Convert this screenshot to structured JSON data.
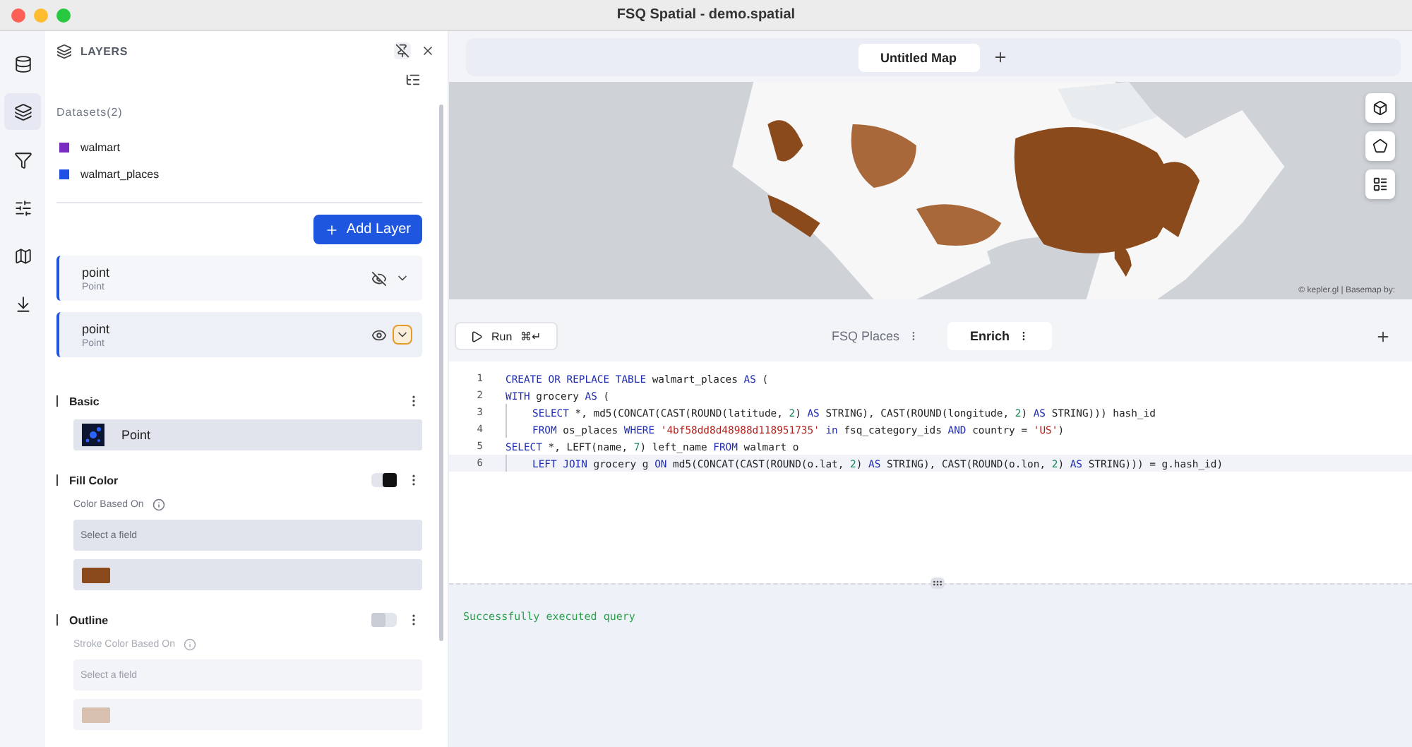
{
  "window": {
    "title": "FSQ Spatial - demo.spatial"
  },
  "rail": [
    {
      "selected": false
    },
    {
      "selected": true
    },
    {
      "selected": false
    },
    {
      "selected": false
    },
    {
      "selected": false
    },
    {
      "selected": false
    }
  ],
  "layers_panel": {
    "title": "LAYERS",
    "datasets_label": "Datasets(2)",
    "datasets": [
      {
        "name": "walmart",
        "color": "#7a2bc0"
      },
      {
        "name": "walmart_places",
        "color": "#1f50e6"
      }
    ],
    "add_button": "Add Layer",
    "layers": [
      {
        "name": "point",
        "type": "Point",
        "visible": false,
        "expanded": false
      },
      {
        "name": "point",
        "type": "Point",
        "visible": true,
        "expanded": true
      }
    ],
    "sections": [
      {
        "kind": "basic",
        "title": "Basic",
        "value": "Point"
      },
      {
        "kind": "color",
        "title": "Fill Color",
        "on": true,
        "label": "Color Based On",
        "placeholder": "Select a field",
        "color": "#8b4a1c"
      },
      {
        "kind": "color",
        "title": "Outline",
        "on": false,
        "label": "Stroke Color Based On",
        "placeholder": "Select a field",
        "color": "#d9c1b1"
      }
    ]
  },
  "map": {
    "tabs": [
      {
        "label": "Untitled Map",
        "selected": true
      }
    ],
    "attribution": "© kepler.gl | Basemap by:"
  },
  "editor": {
    "run_label": "Run",
    "run_shortcut": "⌘↵",
    "tabs": [
      {
        "label": "FSQ Places",
        "selected": false
      },
      {
        "label": "Enrich",
        "selected": true
      }
    ],
    "lines": [
      {
        "number": "1",
        "indent": false,
        "active": false,
        "tokens": [
          {
            "kind": "kw",
            "text": "CREATE OR REPLACE TABLE"
          },
          {
            "kind": "plain",
            "text": " walmart_places "
          },
          {
            "kind": "kw",
            "text": "AS"
          },
          {
            "kind": "plain",
            "text": " ("
          }
        ]
      },
      {
        "number": "2",
        "indent": false,
        "active": false,
        "tokens": [
          {
            "kind": "kw",
            "text": "WITH"
          },
          {
            "kind": "plain",
            "text": " grocery "
          },
          {
            "kind": "kw",
            "text": "AS"
          },
          {
            "kind": "plain",
            "text": " ("
          }
        ]
      },
      {
        "number": "3",
        "indent": true,
        "active": false,
        "tokens": [
          {
            "kind": "kw",
            "text": "SELECT"
          },
          {
            "kind": "plain",
            "text": " *, md5(CONCAT(CAST(ROUND(latitude, "
          },
          {
            "kind": "num",
            "text": "2"
          },
          {
            "kind": "plain",
            "text": ") "
          },
          {
            "kind": "kw",
            "text": "AS"
          },
          {
            "kind": "plain",
            "text": " STRING), CAST(ROUND(longitude, "
          },
          {
            "kind": "num",
            "text": "2"
          },
          {
            "kind": "plain",
            "text": ") "
          },
          {
            "kind": "kw",
            "text": "AS"
          },
          {
            "kind": "plain",
            "text": " STRING))) hash_id"
          }
        ]
      },
      {
        "number": "4",
        "indent": true,
        "active": false,
        "tokens": [
          {
            "kind": "kw",
            "text": "FROM"
          },
          {
            "kind": "plain",
            "text": " os_places "
          },
          {
            "kind": "kw",
            "text": "WHERE"
          },
          {
            "kind": "str",
            "text": " '4bf58dd8d48988d118951735'"
          },
          {
            "kind": "kw",
            "text": " in"
          },
          {
            "kind": "plain",
            "text": " fsq_category_ids "
          },
          {
            "kind": "kw",
            "text": "AND"
          },
          {
            "kind": "plain",
            "text": " country = "
          },
          {
            "kind": "str",
            "text": "'US'"
          },
          {
            "kind": "plain",
            "text": ")"
          }
        ]
      },
      {
        "number": "5",
        "indent": false,
        "active": false,
        "tokens": [
          {
            "kind": "kw",
            "text": "SELECT"
          },
          {
            "kind": "plain",
            "text": " *, LEFT(name, "
          },
          {
            "kind": "num",
            "text": "7"
          },
          {
            "kind": "plain",
            "text": ") left_name "
          },
          {
            "kind": "kw",
            "text": "FROM"
          },
          {
            "kind": "plain",
            "text": " walmart o"
          }
        ]
      },
      {
        "number": "6",
        "indent": true,
        "active": true,
        "tokens": [
          {
            "kind": "kw",
            "text": "LEFT JOIN"
          },
          {
            "kind": "plain",
            "text": " grocery g "
          },
          {
            "kind": "kw",
            "text": "ON"
          },
          {
            "kind": "plain",
            "text": " md5(CONCAT(CAST(ROUND(o.lat, "
          },
          {
            "kind": "num",
            "text": "2"
          },
          {
            "kind": "plain",
            "text": ") "
          },
          {
            "kind": "kw",
            "text": "AS"
          },
          {
            "kind": "plain",
            "text": " STRING), CAST(ROUND(o.lon, "
          },
          {
            "kind": "num",
            "text": "2"
          },
          {
            "kind": "plain",
            "text": ") "
          },
          {
            "kind": "kw",
            "text": "AS"
          },
          {
            "kind": "plain",
            "text": " STRING))) = g.hash_id)"
          }
        ]
      }
    ]
  },
  "results": {
    "message": "Successfully executed query"
  }
}
